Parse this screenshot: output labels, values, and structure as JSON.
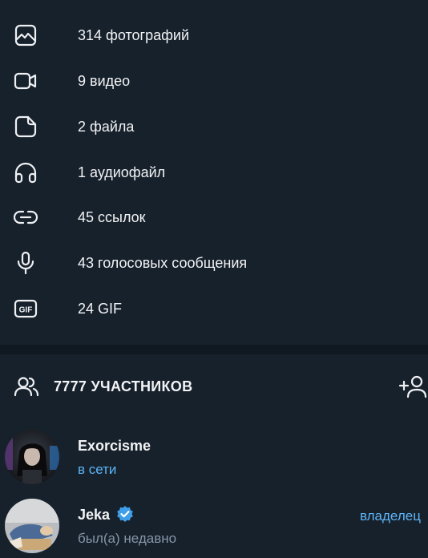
{
  "media": {
    "items": [
      {
        "icon": "photo-icon",
        "label": "314 фотографий"
      },
      {
        "icon": "video-icon",
        "label": "9 видео"
      },
      {
        "icon": "file-icon",
        "label": "2 файла"
      },
      {
        "icon": "headphones-icon",
        "label": "1 аудиофайл"
      },
      {
        "icon": "link-icon",
        "label": "45 ссылок"
      },
      {
        "icon": "microphone-icon",
        "label": "43 голосовых сообщения"
      },
      {
        "icon": "gif-icon",
        "label": "24 GIF"
      }
    ]
  },
  "members": {
    "header_title": "7777 УЧАСТНИКОВ",
    "list": [
      {
        "name": "Exorcisme",
        "status": "в сети",
        "role": ""
      },
      {
        "name": "Jeka",
        "status": "был(а) недавно",
        "role": "владелец",
        "verified": true
      }
    ]
  },
  "colors": {
    "background": "#17212b",
    "divider": "#101921",
    "accent": "#5eb5f7",
    "text": "#f2f3f5",
    "muted": "#8596a8",
    "icon": "#eef0f3"
  }
}
